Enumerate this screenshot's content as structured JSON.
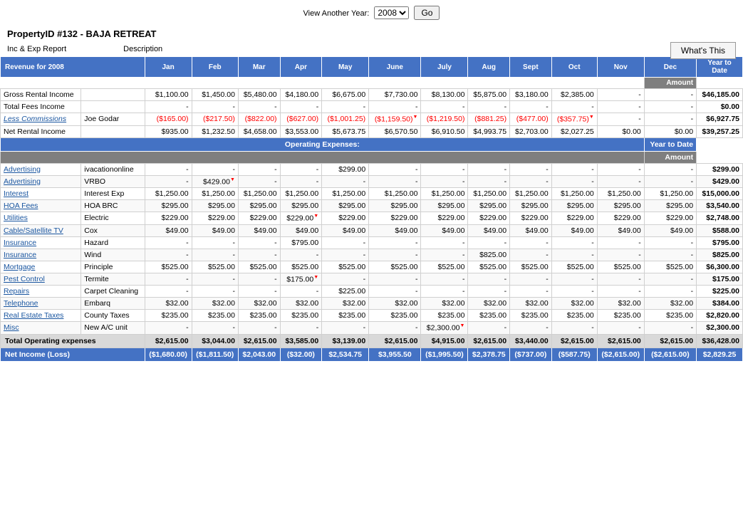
{
  "topBar": {
    "label": "View Another Year:",
    "yearValue": "2008",
    "goButton": "Go"
  },
  "propertyTitle": "PropertyID #132 - BAJA RETREAT",
  "headerLabels": {
    "incExp": "Inc & Exp Report",
    "description": "Description",
    "whatsThis": "What's This"
  },
  "tableHeaders": {
    "revenueFor": "Revenue for 2008",
    "months": [
      "Jan",
      "Feb",
      "Mar",
      "Apr",
      "May",
      "June",
      "July",
      "Aug",
      "Sept",
      "Oct",
      "Nov",
      "Dec"
    ],
    "yearToDate": "Year to Date",
    "amount": "Amount"
  },
  "revenueRows": [
    {
      "label": "Gross Rental Income",
      "desc": "",
      "jan": "$1,100.00",
      "feb": "$1,450.00",
      "mar": "$5,480.00",
      "apr": "$4,180.00",
      "may": "$6,675.00",
      "june": "$7,730.00",
      "july": "$8,130.00",
      "aug": "$5,875.00",
      "sept": "$3,180.00",
      "oct": "$2,385.00",
      "nov": "-",
      "dec": "-",
      "ytd": "$46,185.00"
    },
    {
      "label": "Total Fees Income",
      "desc": "",
      "jan": "-",
      "feb": "-",
      "mar": "-",
      "apr": "-",
      "may": "-",
      "june": "-",
      "july": "-",
      "aug": "-",
      "sept": "-",
      "oct": "-",
      "nov": "-",
      "dec": "-",
      "ytd": "$0.00"
    },
    {
      "label": "Less Commissions",
      "desc": "Joe Godar",
      "jan": "($165.00)",
      "feb": "($217.50)",
      "mar": "($822.00)",
      "apr": "($627.00)",
      "may": "($1,001.25)",
      "june": "($1,159.50)",
      "july": "($1,219.50)",
      "aug": "($881.25)",
      "sept": "($477.00)",
      "oct": "($357.75)",
      "nov": "-",
      "dec": "-",
      "ytd": "$6,927.75"
    },
    {
      "label": "Net Rental Income",
      "desc": "",
      "jan": "$935.00",
      "feb": "$1,232.50",
      "mar": "$4,658.00",
      "apr": "$3,553.00",
      "may": "$5,673.75",
      "june": "$6,570.50",
      "july": "$6,910.50",
      "aug": "$4,993.75",
      "sept": "$2,703.00",
      "oct": "$2,027.25",
      "nov": "$0.00",
      "dec": "$0.00",
      "ytd": "$39,257.25"
    }
  ],
  "operatingExpenses": {
    "title": "Operating Expenses:",
    "ytdLabel": "Year to Date",
    "amountLabel": "Amount"
  },
  "expenseRows": [
    {
      "label": "Advertising",
      "desc": "ivacationonline",
      "jan": "-",
      "feb": "-",
      "mar": "-",
      "apr": "-",
      "may": "$299.00",
      "june": "-",
      "july": "-",
      "aug": "-",
      "sept": "-",
      "oct": "-",
      "nov": "-",
      "dec": "-",
      "ytd": "$299.00"
    },
    {
      "label": "Advertising",
      "desc": "VRBO",
      "jan": "-",
      "feb": "$429.00",
      "mar": "-",
      "apr": "-",
      "may": "-",
      "june": "-",
      "july": "-",
      "aug": "-",
      "sept": "-",
      "oct": "-",
      "nov": "-",
      "dec": "-",
      "ytd": "$429.00"
    },
    {
      "label": "Interest",
      "desc": "Interest Exp",
      "jan": "$1,250.00",
      "feb": "$1,250.00",
      "mar": "$1,250.00",
      "apr": "$1,250.00",
      "may": "$1,250.00",
      "june": "$1,250.00",
      "july": "$1,250.00",
      "aug": "$1,250.00",
      "sept": "$1,250.00",
      "oct": "$1,250.00",
      "nov": "$1,250.00",
      "dec": "$1,250.00",
      "ytd": "$15,000.00"
    },
    {
      "label": "HOA Fees",
      "desc": "HOA BRC",
      "jan": "$295.00",
      "feb": "$295.00",
      "mar": "$295.00",
      "apr": "$295.00",
      "may": "$295.00",
      "june": "$295.00",
      "july": "$295.00",
      "aug": "$295.00",
      "sept": "$295.00",
      "oct": "$295.00",
      "nov": "$295.00",
      "dec": "$295.00",
      "ytd": "$3,540.00"
    },
    {
      "label": "Utilities",
      "desc": "Electric",
      "jan": "$229.00",
      "feb": "$229.00",
      "mar": "$229.00",
      "apr": "$229.00",
      "may": "$229.00",
      "june": "$229.00",
      "july": "$229.00",
      "aug": "$229.00",
      "sept": "$229.00",
      "oct": "$229.00",
      "nov": "$229.00",
      "dec": "$229.00",
      "ytd": "$2,748.00"
    },
    {
      "label": "Cable/Satellite TV",
      "desc": "Cox",
      "jan": "$49.00",
      "feb": "$49.00",
      "mar": "$49.00",
      "apr": "$49.00",
      "may": "$49.00",
      "june": "$49.00",
      "july": "$49.00",
      "aug": "$49.00",
      "sept": "$49.00",
      "oct": "$49.00",
      "nov": "$49.00",
      "dec": "$49.00",
      "ytd": "$588.00"
    },
    {
      "label": "Insurance",
      "desc": "Hazard",
      "jan": "-",
      "feb": "-",
      "mar": "-",
      "apr": "$795.00",
      "may": "-",
      "june": "-",
      "july": "-",
      "aug": "-",
      "sept": "-",
      "oct": "-",
      "nov": "-",
      "dec": "-",
      "ytd": "$795.00"
    },
    {
      "label": "Insurance",
      "desc": "Wind",
      "jan": "-",
      "feb": "-",
      "mar": "-",
      "apr": "-",
      "may": "-",
      "june": "-",
      "july": "-",
      "aug": "$825.00",
      "sept": "-",
      "oct": "-",
      "nov": "-",
      "dec": "-",
      "ytd": "$825.00"
    },
    {
      "label": "Mortgage",
      "desc": "Principle",
      "jan": "$525.00",
      "feb": "$525.00",
      "mar": "$525.00",
      "apr": "$525.00",
      "may": "$525.00",
      "june": "$525.00",
      "july": "$525.00",
      "aug": "$525.00",
      "sept": "$525.00",
      "oct": "$525.00",
      "nov": "$525.00",
      "dec": "$525.00",
      "ytd": "$6,300.00"
    },
    {
      "label": "Pest Control",
      "desc": "Termite",
      "jan": "-",
      "feb": "-",
      "mar": "-",
      "apr": "$175.00",
      "may": "-",
      "june": "-",
      "july": "-",
      "aug": "-",
      "sept": "-",
      "oct": "-",
      "nov": "-",
      "dec": "-",
      "ytd": "$175.00"
    },
    {
      "label": "Repairs",
      "desc": "Carpet Cleaning",
      "jan": "-",
      "feb": "-",
      "mar": "-",
      "apr": "-",
      "may": "$225.00",
      "june": "-",
      "july": "-",
      "aug": "-",
      "sept": "-",
      "oct": "-",
      "nov": "-",
      "dec": "-",
      "ytd": "$225.00"
    },
    {
      "label": "Telephone",
      "desc": "Embarq",
      "jan": "$32.00",
      "feb": "$32.00",
      "mar": "$32.00",
      "apr": "$32.00",
      "may": "$32.00",
      "june": "$32.00",
      "july": "$32.00",
      "aug": "$32.00",
      "sept": "$32.00",
      "oct": "$32.00",
      "nov": "$32.00",
      "dec": "$32.00",
      "ytd": "$384.00"
    },
    {
      "label": "Real Estate Taxes",
      "desc": "County Taxes",
      "jan": "$235.00",
      "feb": "$235.00",
      "mar": "$235.00",
      "apr": "$235.00",
      "may": "$235.00",
      "june": "$235.00",
      "july": "$235.00",
      "aug": "$235.00",
      "sept": "$235.00",
      "oct": "$235.00",
      "nov": "$235.00",
      "dec": "$235.00",
      "ytd": "$2,820.00"
    },
    {
      "label": "Misc",
      "desc": "New A/C unit",
      "jan": "-",
      "feb": "-",
      "mar": "-",
      "apr": "-",
      "may": "-",
      "june": "-",
      "july": "$2,300.00",
      "aug": "-",
      "sept": "-",
      "oct": "-",
      "nov": "-",
      "dec": "-",
      "ytd": "$2,300.00"
    }
  ],
  "totalRow": {
    "label": "Total Operating expenses",
    "jan": "$2,615.00",
    "feb": "$3,044.00",
    "mar": "$2,615.00",
    "apr": "$3,585.00",
    "may": "$3,139.00",
    "june": "$2,615.00",
    "july": "$4,915.00",
    "aug": "$2,615.00",
    "sept": "$3,440.00",
    "oct": "$2,615.00",
    "nov": "$2,615.00",
    "dec": "$2,615.00",
    "ytd": "$36,428.00"
  },
  "netIncomeRow": {
    "label": "Net Income (Loss)",
    "jan": "($1,680.00)",
    "feb": "($1,811.50)",
    "mar": "$2,043.00",
    "apr": "($32.00)",
    "may": "$2,534.75",
    "june": "$3,955.50",
    "july": "($1,995.50)",
    "aug": "$2,378.75",
    "sept": "($737.00)",
    "oct": "($587.75)",
    "nov": "($2,615.00)",
    "dec": "($2,615.00)",
    "ytd": "$2,829.25"
  },
  "redArrowCells": {
    "commissions_june": true,
    "commissions_oct": true,
    "advertising_feb": true,
    "utilities_apr": true,
    "pestcontrol_apr": true,
    "misc_july": true
  }
}
